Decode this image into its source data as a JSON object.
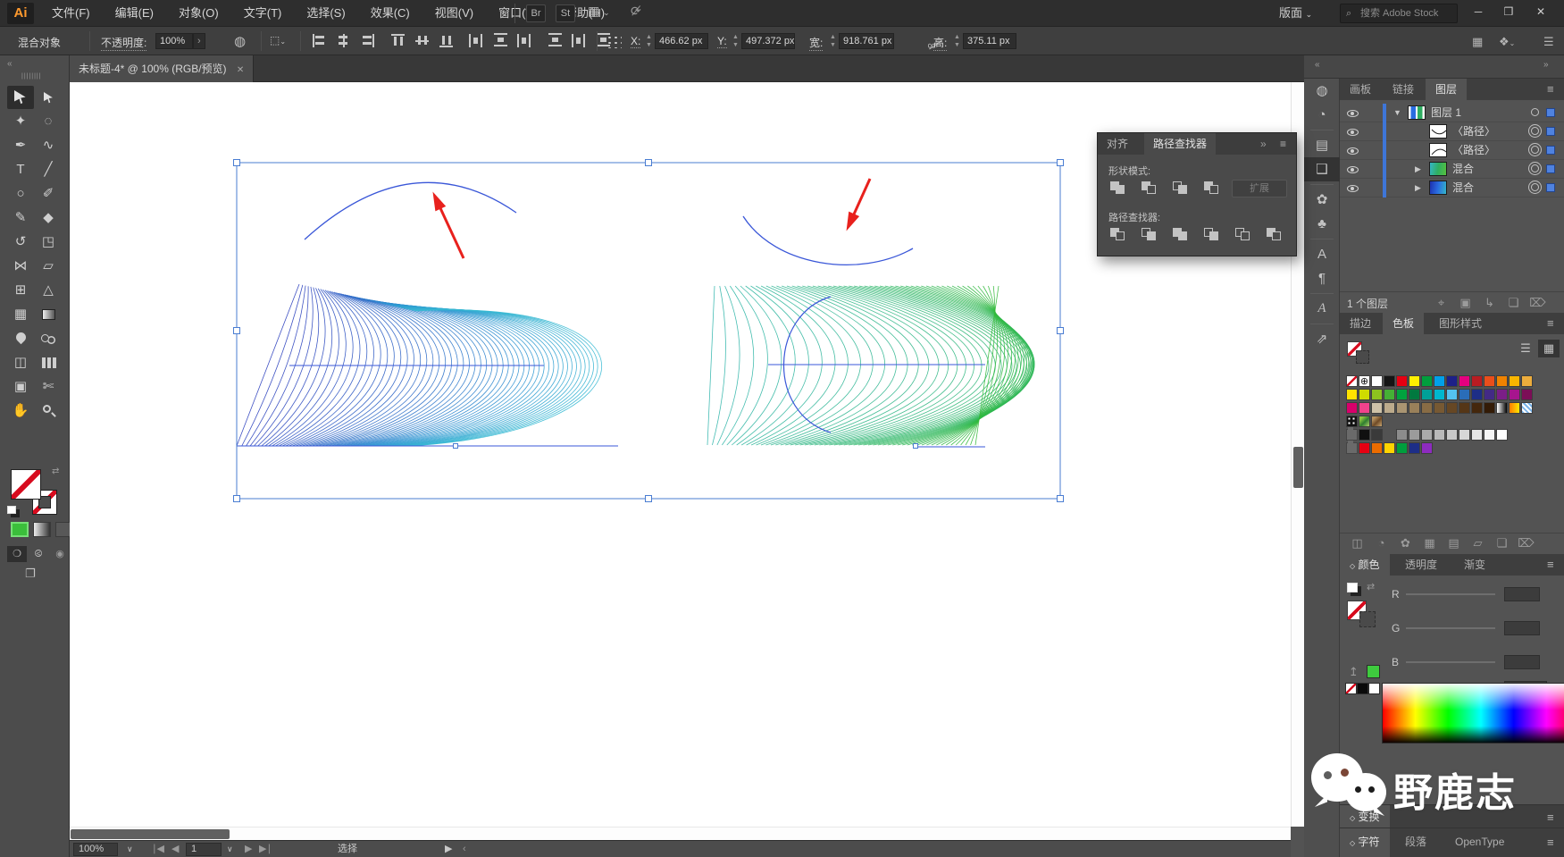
{
  "window": {
    "minimize": "─",
    "maximize": "❒",
    "close": "✕"
  },
  "menubar": {
    "logo": "Ai",
    "items": [
      "文件(F)",
      "编辑(E)",
      "对象(O)",
      "文字(T)",
      "选择(S)",
      "效果(C)",
      "视图(V)",
      "窗口(W)",
      "帮助(H)"
    ],
    "badge_bridge": "Br",
    "badge_stock": "St",
    "workspace_label": "版面",
    "search_placeholder": "搜索 Adobe Stock"
  },
  "controlbar": {
    "context_label": "混合对象",
    "opacity_label": "不透明度:",
    "opacity_value": "100%",
    "fields": {
      "x_label": "X:",
      "x_value": "466.62 px",
      "y_label": "Y:",
      "y_value": "497.372 px",
      "w_label": "宽:",
      "w_value": "918.761 px",
      "h_label": "高:",
      "h_value": "375.11 px"
    }
  },
  "tabbar": {
    "doc_title": "未标题-4* @ 100% (RGB/预览)"
  },
  "toolbar": {
    "tools": [
      {
        "n": "selection",
        "g": "@cursor",
        "a": 1
      },
      {
        "n": "direct-selection",
        "g": "@cursor2"
      },
      {
        "n": "magic-wand",
        "g": "✦"
      },
      {
        "n": "lasso",
        "g": "◌"
      },
      {
        "n": "pen",
        "g": "✒"
      },
      {
        "n": "curvature",
        "g": "∿"
      },
      {
        "n": "type",
        "g": "T"
      },
      {
        "n": "line-segment",
        "g": "╱"
      },
      {
        "n": "ellipse",
        "g": "○"
      },
      {
        "n": "paintbrush",
        "g": "✐"
      },
      {
        "n": "shaper",
        "g": "✎"
      },
      {
        "n": "eraser",
        "g": "◆"
      },
      {
        "n": "rotate",
        "g": "↺"
      },
      {
        "n": "scale",
        "g": "◳"
      },
      {
        "n": "width",
        "g": "⋈"
      },
      {
        "n": "free-transform",
        "g": "▱"
      },
      {
        "n": "shape-builder",
        "g": "⊞"
      },
      {
        "n": "perspective-grid",
        "g": "△"
      },
      {
        "n": "mesh",
        "g": "▦"
      },
      {
        "n": "gradient",
        "g": "@grad"
      },
      {
        "n": "eyedropper",
        "g": "@dropper"
      },
      {
        "n": "blend",
        "g": "@blend"
      },
      {
        "n": "symbol-sprayer",
        "g": "◫"
      },
      {
        "n": "column-graph",
        "g": "@graph"
      },
      {
        "n": "artboard",
        "g": "▣"
      },
      {
        "n": "slice",
        "g": "✄"
      },
      {
        "n": "hand",
        "g": "✋"
      },
      {
        "n": "zoom",
        "g": "@zoom"
      }
    ]
  },
  "pathfinder_panel": {
    "tab_align": "对齐",
    "tab_pathfinder": "路径查找器",
    "overflow_icon": "»",
    "menu_icon": "≡",
    "shape_modes_label": "形状模式:",
    "expand_button": "扩展",
    "pathfinder_label": "路径查找器:",
    "shape_modes": [
      "unite",
      "minus-front",
      "intersect",
      "exclude"
    ],
    "pathfinders": [
      "divide",
      "trim",
      "merge",
      "crop",
      "outline",
      "minus-back"
    ]
  },
  "dock_icons": [
    {
      "n": "color-guide",
      "g": "◍"
    },
    {
      "n": "adobe-color-themes",
      "g": "◔"
    },
    {
      "n": "align",
      "g": "▤",
      "sep": 1
    },
    {
      "n": "pathfinder",
      "g": "❑",
      "a": 1
    },
    {
      "n": "brushes",
      "g": "✿",
      "sep": 1
    },
    {
      "n": "symbols",
      "g": "♣"
    },
    {
      "n": "character-styles",
      "g": "A",
      "sep": 1
    },
    {
      "n": "paragraph-styles",
      "g": "¶"
    },
    {
      "n": "glyphs",
      "g": "A",
      "italic": 1,
      "sep": 1
    },
    {
      "n": "export",
      "g": "⇗",
      "sep": 1
    }
  ],
  "layers_panel": {
    "tabs": [
      "画板",
      "链接",
      "图层"
    ],
    "active_tab": "图层",
    "rows": [
      {
        "name": "图层 1",
        "kind": "layer"
      },
      {
        "name": "〈路径〉",
        "kind": "path",
        "thumb": "arc-down"
      },
      {
        "name": "〈路径〉",
        "kind": "path",
        "thumb": "arc-up"
      },
      {
        "name": "混合",
        "kind": "blend",
        "thumb": "blend-green"
      },
      {
        "name": "混合",
        "kind": "blend",
        "thumb": "blend-blue"
      }
    ],
    "status": "1 个图层",
    "footer_icons": [
      {
        "n": "locate-object",
        "g": "⌖"
      },
      {
        "n": "clipping-mask",
        "g": "▣"
      },
      {
        "n": "new-sublayer",
        "g": "↳"
      },
      {
        "n": "new-layer",
        "g": "❏"
      },
      {
        "n": "delete-layer",
        "g": "⌦"
      }
    ]
  },
  "swatches_panel": {
    "tabs": [
      "描边",
      "色板",
      "图形样式"
    ],
    "active_tab": "色板",
    "rows": [
      [
        "none",
        "reg",
        "#ffffff",
        "#151515",
        "#e60012",
        "#fff000",
        "#009e3d",
        "#00a0e9",
        "#1d2088",
        "#e3007f",
        "#b81c22",
        "#e94e1b",
        "#ef8200",
        "#f8b500",
        "#edad3c"
      ],
      [
        "#ffe200",
        "#cfdb00",
        "#8dc21f",
        "#45b035",
        "#00a23e",
        "#00793f",
        "#00a098",
        "#00b7ce",
        "#54c2f0",
        "#2a6db8",
        "#1d2e87",
        "#432a85",
        "#7b1e87",
        "#a7158e",
        "#7c0e57"
      ],
      [
        "#d8006b",
        "#f1428c",
        "#cec2a8",
        "#bcab8c",
        "#aa9572",
        "#99805a",
        "#886c45",
        "#775933",
        "#664724",
        "#553617",
        "#44270c",
        "#331b06",
        "grad-bw",
        "grad-oy",
        "pat-blue"
      ],
      [
        "pat-dots",
        "pat-green",
        "pat-brown"
      ],
      [
        "folder",
        "#101010",
        "#3a3a3a",
        "gap",
        "#8c8c8c",
        "#9b9b9b",
        "#aaaaaa",
        "#b9b9b9",
        "#c8c8c8",
        "#d7d7d7",
        "#e6e6e6",
        "#f5f5f5",
        "#ffffff"
      ],
      [
        "folder",
        "#e60012",
        "#eb6c00",
        "#ffd400",
        "#009e3d",
        "#1d2e87",
        "#8d2bbf"
      ]
    ],
    "footer_icons": [
      {
        "n": "swatch-libraries",
        "g": "◫"
      },
      {
        "n": "color-themes",
        "g": "◔"
      },
      {
        "n": "swatch-kinds",
        "g": "✿"
      },
      {
        "n": "swatch-options",
        "g": "▦"
      },
      {
        "n": "show-list",
        "g": "▤"
      },
      {
        "n": "new-color-group",
        "g": "▱"
      },
      {
        "n": "new-swatch",
        "g": "❏"
      },
      {
        "n": "delete-swatch",
        "g": "⌦"
      }
    ]
  },
  "color_panel": {
    "tabs": [
      "颜色",
      "透明度",
      "渐变"
    ],
    "active_tab": "颜色",
    "channels": [
      "R",
      "G",
      "B"
    ],
    "hex_label": "#",
    "last_color": "#3ecb3e"
  },
  "transform_panel": {
    "label": "变换"
  },
  "type_panel": {
    "tabs": [
      "字符",
      "段落",
      "OpenType"
    ],
    "active_tab": "字符"
  },
  "statusbar": {
    "zoom": "100%",
    "artboard_number": "1",
    "status_label": "选择"
  },
  "watermark": {
    "text": "野鹿志"
  },
  "artwork": {
    "selection_color": "#4a7dd2",
    "handle_fill": "#ffffff",
    "path_blue": "#3a57d8",
    "arrow_red": "#e8211d",
    "blend_left": {
      "count": 56,
      "hue_from": 232,
      "hue_to": 190,
      "sat": 64,
      "light_from": 45,
      "light_to": 52
    },
    "blend_right": {
      "count": 56,
      "hue_from": 176,
      "hue_to": 122,
      "sat": 58,
      "light_from": 45,
      "light_to": 46
    }
  }
}
